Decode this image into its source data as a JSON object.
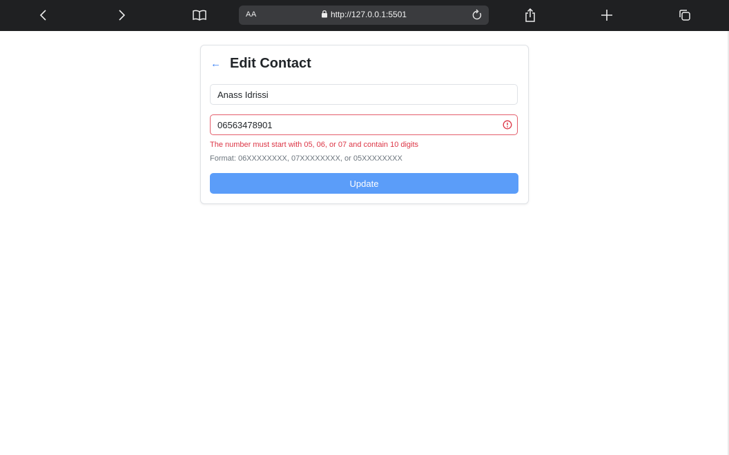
{
  "browser": {
    "text_size_label": "AA",
    "url": "http://127.0.0.1:5501",
    "icons": {
      "back": "chevron-left-icon",
      "forward": "chevron-right-icon",
      "bookmarks": "open-book-icon",
      "lock": "lock-icon",
      "reload": "reload-icon",
      "share": "share-icon",
      "new_tab": "plus-icon",
      "tabs": "tabs-icon"
    }
  },
  "form": {
    "title": "Edit Contact",
    "back_icon": "←",
    "name_value": "Anass Idrissi",
    "phone_value": "06563478901",
    "error_message": "The number must start with 05, 06, or 07 and contain 10 digits",
    "format_hint": "Format: 06XXXXXXXX, 07XXXXXXXX, or 05XXXXXXXX",
    "submit_label": "Update"
  },
  "colors": {
    "accent": "#3b82f6",
    "button": "#5b9df9",
    "error": "#dc3545",
    "toolbar": "#1f2022"
  }
}
